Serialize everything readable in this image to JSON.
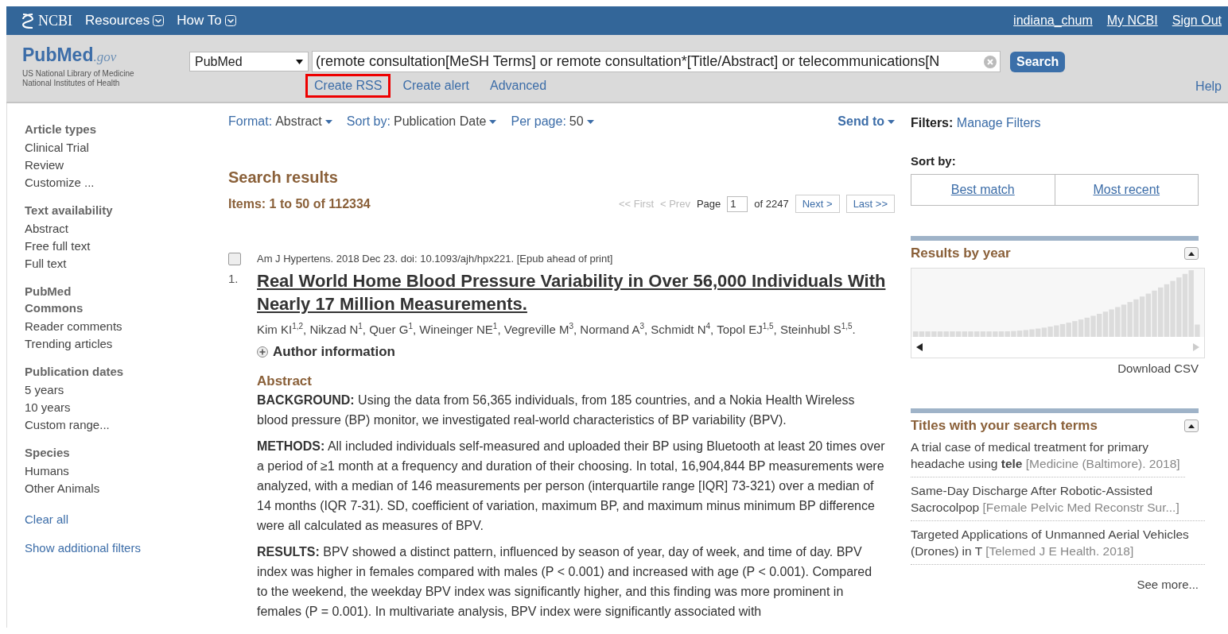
{
  "top_bar": {
    "logo": "NCBI",
    "menus": [
      {
        "label": "Resources"
      },
      {
        "label": "How To"
      }
    ],
    "user_links": [
      "indiana_chum",
      "My NCBI",
      "Sign Out"
    ]
  },
  "header": {
    "brand": "PubMed",
    "brand_suffix": ".gov",
    "org_lines": [
      "US National Library of Medicine",
      "National Institutes of Health"
    ],
    "database": "PubMed",
    "query": "(remote consultation[MeSH Terms] or remote consultation*[Title/Abstract] or telecommunications[N",
    "search_button": "Search",
    "links": [
      {
        "label": "Create RSS",
        "highlighted": true
      },
      {
        "label": "Create alert",
        "highlighted": false
      },
      {
        "label": "Advanced",
        "highlighted": false
      }
    ],
    "help": "Help"
  },
  "sidebar": {
    "groups": [
      {
        "title": "Article types",
        "items": [
          "Clinical Trial",
          "Review",
          "Customize ..."
        ]
      },
      {
        "title": "Text availability",
        "items": [
          "Abstract",
          "Free full text",
          "Full text"
        ]
      },
      {
        "title": "PubMed Commons",
        "items": [
          "Reader comments",
          "Trending articles"
        ]
      },
      {
        "title": "Publication dates",
        "items": [
          "5 years",
          "10 years",
          "Custom range..."
        ]
      },
      {
        "title": "Species",
        "items": [
          "Humans",
          "Other Animals"
        ]
      }
    ],
    "links": [
      "Clear all",
      "Show additional filters"
    ]
  },
  "toolbar": {
    "options": [
      {
        "label": "Format:",
        "value": "Abstract"
      },
      {
        "label": "Sort by:",
        "value": "Publication Date"
      },
      {
        "label": "Per page:",
        "value": "50"
      }
    ],
    "send_to": "Send to"
  },
  "results": {
    "title": "Search results",
    "count": "Items: 1 to 50 of 112334",
    "pager": {
      "first": "<< First",
      "prev": "< Prev",
      "page_label": "Page",
      "page": "1",
      "of": "of 2247",
      "next": "Next >",
      "last": "Last >>"
    },
    "item": {
      "checked": false,
      "number": "1.",
      "journal": "Am J Hypertens.",
      "citation": "2018 Dec 23. doi: 10.1093/ajh/hpx221. [Epub ahead of print]",
      "title": "Real World Home Blood Pressure Variability in Over 56,000 Individuals With Nearly 17 Million Measurements.",
      "authors": [
        {
          "name": "Kim KI",
          "after": "$^{1,2}$, "
        },
        {
          "name": "Nikzad N",
          "after": "$^{1}$, "
        },
        {
          "name": "Quer G",
          "after": "$^{1}$, "
        },
        {
          "name": "Wineinger NE",
          "after": "$^{1}$, "
        },
        {
          "name": "Vegreville M",
          "after": "$^{3}$, "
        },
        {
          "name": "Normand A",
          "after": "$^{3}$, "
        },
        {
          "name": "Schmidt N",
          "after": "$^{4}$, "
        },
        {
          "name": "Topol EJ",
          "after": "$^{1,5}$, "
        },
        {
          "name": "Steinhubl S",
          "after": "$^{1,5}$."
        }
      ],
      "author_info": "Author information",
      "abstract_heading": "Abstract",
      "paragraphs": [
        "**BACKGROUND:** Using the data from 56,365 individuals, from 185 countries, and a Nokia Health Wireless blood pressure (BP) monitor, we investigated real-world characteristics of BP variability (BPV).",
        "**METHODS:** All included individuals self-measured and uploaded their BP using Bluetooth at least 20 times over a period of ≥1 month at a frequency and duration of their choosing. In total, 16,904,844 BP measurements were analyzed, with a median of 146 measurements per person (interquartile range [IQR] 73-321) over a median of 14 months (IQR 7-31). SD, coefficient of variation, maximum BP, and maximum minus minimum BP difference were all calculated as measures of BPV.",
        "**RESULTS:** BPV showed a distinct pattern, influenced by season of year, day of week, and time of day. BPV index was higher in females compared with males (P < 0.001) and increased with age (P < 0.001). Compared to the weekend, the weekday BPV index was significantly higher, and this finding was more prominent in females (P = 0.001). In multivariate analysis, BPV index were significantly associated with"
      ]
    }
  },
  "right": {
    "filters_label": "Filters:",
    "manage_filters": "Manage Filters",
    "sort_label": "Sort by:",
    "sort_options": [
      "Best match",
      "Most recent"
    ],
    "year_panel": {
      "title": "Results by year",
      "download": "Download CSV"
    },
    "titles_panel": {
      "title": "Titles with your search terms",
      "items": [
        {
          "title": "A trial case of medical treatment for primary headache using **tele**",
          "source": "[Medicine (Baltimore). 2018]"
        },
        {
          "title": "Same-Day Discharge After Robotic-Assisted Sacrocolpop",
          "source": "[Female Pelvic Med Reconstr Sur...]"
        },
        {
          "title": "Targeted Applications of Unmanned Aerial Vehicles (Drones) in T",
          "source": "[Telemed J E Health. 2018]"
        }
      ],
      "see_more": "See more..."
    }
  }
}
